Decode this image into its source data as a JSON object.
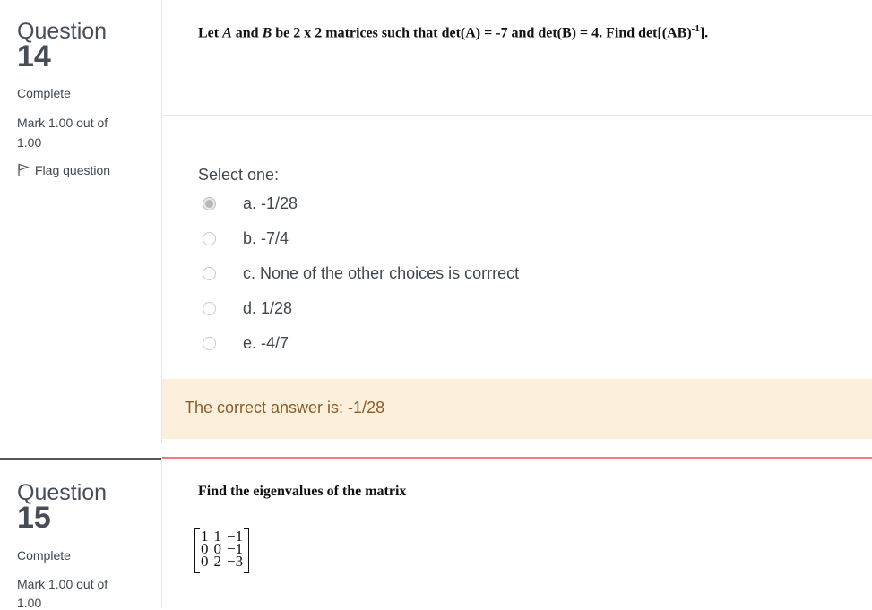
{
  "question14": {
    "word": "Question",
    "number": "14",
    "status": "Complete",
    "mark_line1": "Mark 1.00 out of",
    "mark_line2": "1.00",
    "flag_label": "Flag question",
    "text_parts": {
      "p1": "Let ",
      "A": "A",
      "p2": " and ",
      "B": "B",
      "p3": " be 2 x 2 matrices such that det(A) = -7 and det(B) = 4. Find det[(AB)",
      "sup": "-1",
      "p4": "]."
    },
    "select_one": "Select one:",
    "options": [
      {
        "label": "a. -1/28",
        "selected": true
      },
      {
        "label": "b. -7/4",
        "selected": false
      },
      {
        "label": "c. None of the other choices is corrrect",
        "selected": false
      },
      {
        "label": "d. 1/28",
        "selected": false
      },
      {
        "label": "e. -4/7",
        "selected": false
      }
    ],
    "feedback": "The correct answer is: -1/28"
  },
  "question15": {
    "word": "Question",
    "number": "15",
    "status": "Complete",
    "mark_line1": "Mark 1.00 out of",
    "mark_line2": "1.00",
    "text": "Find the eigenvalues of the matrix",
    "matrix": [
      [
        "1",
        "1",
        "−1"
      ],
      [
        "0",
        "0",
        "−1"
      ],
      [
        "0",
        "2",
        "−3"
      ]
    ]
  },
  "colors": {
    "feedback_bg": "#fcefdc",
    "feedback_text": "#8a5d2a",
    "separator_accent": "#f07a88"
  },
  "icons": {
    "flag": "flag-icon"
  }
}
